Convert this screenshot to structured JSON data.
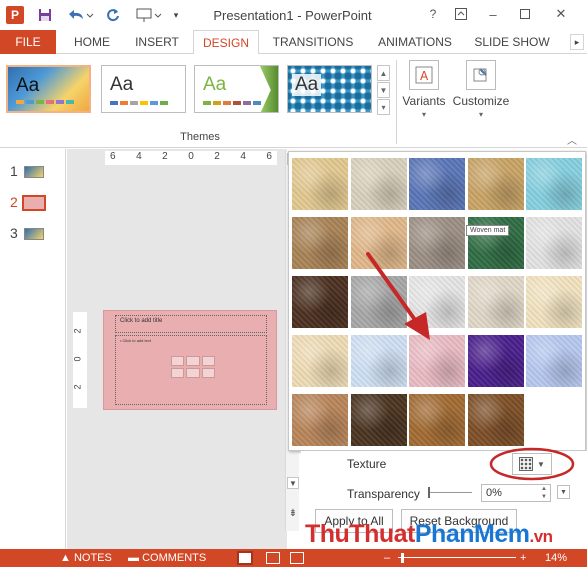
{
  "titlebar": {
    "app_icon": "P",
    "doc_title": "Presentation1 - PowerPoint",
    "help_label": "?",
    "icons": [
      "powerpoint-icon",
      "save-icon",
      "undo-icon",
      "redo-icon",
      "presenter-icon",
      "customize-qat-icon",
      "ribbon-display-icon",
      "minimize-icon",
      "maximize-icon",
      "close-icon"
    ]
  },
  "tabs": {
    "file": "FILE",
    "home": "HOME",
    "insert": "INSERT",
    "design": "DESIGN",
    "transitions": "TRANSITIONS",
    "animations": "ANIMATIONS",
    "slideshow": "SLIDE SHOW"
  },
  "ribbon": {
    "themes_group": "Themes",
    "theme_thumbnails": [
      {
        "label": "Aa",
        "swatches": [
          "#f0a840",
          "#4f9ad6",
          "#7cb342",
          "#e57373",
          "#9575cd",
          "#4db6ac"
        ]
      },
      {
        "label": "Aa",
        "swatches": [
          "#4472c4",
          "#ed7d31",
          "#a5a5a5",
          "#ffc000",
          "#5b9bd5",
          "#70ad47"
        ]
      },
      {
        "label": "Aa",
        "swatches": [
          "#7cb342",
          "#d4a017",
          "#e07b39",
          "#b0503c",
          "#8e6d9e",
          "#4b8bbe"
        ]
      },
      {
        "label": "Aa",
        "swatches": [
          "#1f4e79",
          "#2e75b6",
          "#9dc3e6",
          "#ffc000",
          "#c55a11",
          "#548235"
        ]
      }
    ],
    "variants_label": "Variants",
    "customize_label": "Customize"
  },
  "thumbnails": [
    {
      "number": "1"
    },
    {
      "number": "2",
      "selected": true
    },
    {
      "number": "3"
    }
  ],
  "editor": {
    "h_ruler": [
      "6",
      "4",
      "2",
      "0",
      "2",
      "4",
      "6"
    ],
    "v_ruler": [
      "2",
      "0",
      "2"
    ],
    "slide_title_placeholder": "Click to add title",
    "slide_content_placeholder": "• Click to add text"
  },
  "texture_gallery": {
    "tooltip": "Woven mat",
    "textures": [
      {
        "name": "Papyrus",
        "color": "#e3c990"
      },
      {
        "name": "Canvas",
        "color": "#d9d1bd"
      },
      {
        "name": "Denim",
        "color": "#5a76b8"
      },
      {
        "name": "Woven mat",
        "color": "#c9a466"
      },
      {
        "name": "Water droplets",
        "color": "#86d0e0"
      },
      {
        "name": "Paper bag",
        "color": "#a98356"
      },
      {
        "name": "Fish fossil",
        "color": "#e1b88a"
      },
      {
        "name": "Sand",
        "color": "#9d9085"
      },
      {
        "name": "Green marble",
        "color": "#2f6d43"
      },
      {
        "name": "White marble",
        "color": "#e3e3e3"
      },
      {
        "name": "Brown marble",
        "color": "#4b3020"
      },
      {
        "name": "Granite",
        "color": "#a8a8a8"
      },
      {
        "name": "Newsprint",
        "color": "#e6e6e6"
      },
      {
        "name": "Recycled paper",
        "color": "#e1d8c8"
      },
      {
        "name": "Parchment",
        "color": "#f2e3c0"
      },
      {
        "name": "Stationery",
        "color": "#efdcb5"
      },
      {
        "name": "Blue tissue paper",
        "color": "#cfe0f4"
      },
      {
        "name": "Pink tissue paper",
        "color": "#ebbcc4"
      },
      {
        "name": "Purple mesh",
        "color": "#4a1f8c"
      },
      {
        "name": "Bouquet",
        "color": "#b7c8f0"
      },
      {
        "name": "Cork",
        "color": "#b9865a"
      },
      {
        "name": "Walnut",
        "color": "#4a3320"
      },
      {
        "name": "Oak",
        "color": "#a26b33"
      },
      {
        "name": "Medium wood",
        "color": "#7d4f27"
      }
    ]
  },
  "format_pane": {
    "texture_label": "Texture",
    "transparency_label": "Transparency",
    "transparency_value": "0%",
    "transparency_fraction": 0,
    "apply_all_label": "Apply to All",
    "reset_label": "Reset Background"
  },
  "watermark": {
    "part1": "Thu",
    "part2": "Thuat",
    "part3": "Phan",
    "part4": "Mem",
    "part5": ".vn"
  },
  "statusbar": {
    "notes": "NOTES",
    "comments": "COMMENTS",
    "zoom": "14%",
    "zoom_fraction": 0.14,
    "zoom_minus": "–",
    "zoom_plus": "+"
  },
  "colors": {
    "accent": "#d24726",
    "annotation_red": "#c62828"
  }
}
